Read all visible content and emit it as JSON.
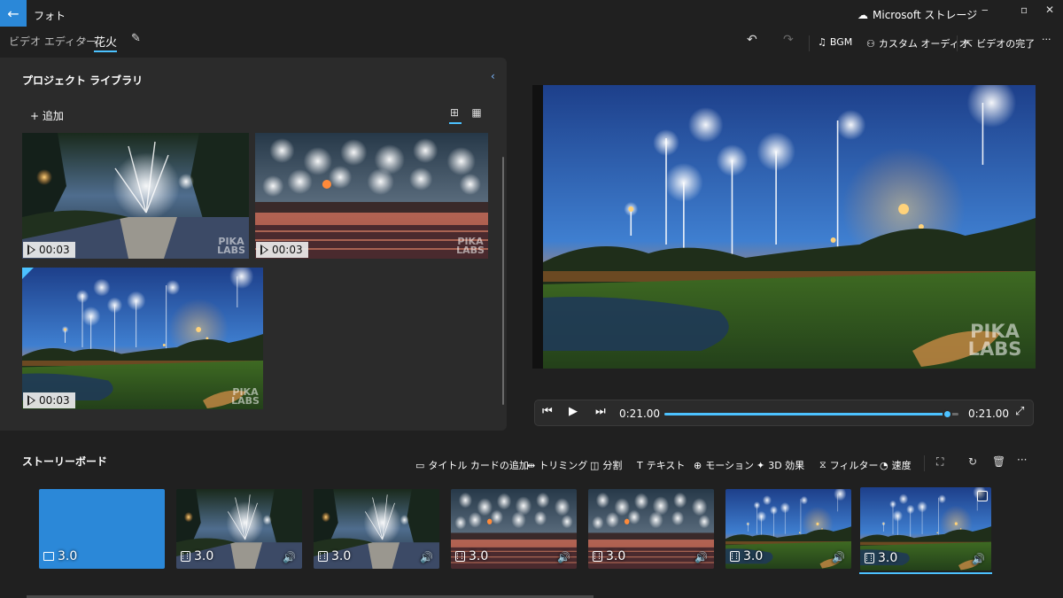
{
  "titlebar": {
    "app_name": "フォト",
    "storage_label": "Microsoft ストレージ",
    "minimize": "‒",
    "maximize": "▫",
    "close": "✕"
  },
  "breadcrumb": {
    "root": "ビデオ エディター",
    "separator": "›",
    "current": "花火"
  },
  "toolbar": {
    "bgm_label": "BGM",
    "custom_audio_label": "カスタム オーディオ",
    "finish_label": "ビデオの完了",
    "more": "···"
  },
  "library": {
    "title": "プロジェクト ライブラリ",
    "add_label": "+ 追加",
    "items": [
      {
        "duration": "00:03",
        "watermark": "PIKA LABS"
      },
      {
        "duration": "00:03",
        "watermark": "PIKA LABS"
      },
      {
        "duration": "00:03",
        "watermark": "PIKA LABS"
      }
    ]
  },
  "preview": {
    "watermark": "PIKA LABS"
  },
  "player": {
    "current_time": "0:21.00",
    "total_time": "0:21.00",
    "progress": 0.96
  },
  "storyboard": {
    "title": "ストーリーボード",
    "actions": {
      "title_card": "タイトル カードの追加",
      "trim": "トリミング",
      "split": "分割",
      "text": "テキスト",
      "motion": "モーション",
      "effects_3d": "3D 効果",
      "filter": "フィルター",
      "speed": "速度",
      "more": "···"
    },
    "clips": [
      {
        "duration": "3.0",
        "type": "title-card"
      },
      {
        "duration": "3.0",
        "type": "video"
      },
      {
        "duration": "3.0",
        "type": "video"
      },
      {
        "duration": "3.0",
        "type": "video"
      },
      {
        "duration": "3.0",
        "type": "video"
      },
      {
        "duration": "3.0",
        "type": "video"
      },
      {
        "duration": "3.0",
        "type": "video",
        "selected": true
      }
    ]
  },
  "colors": {
    "accent": "#4cc2ff",
    "title_card_blue": "#2b88d8",
    "panel": "#2b2b2b",
    "background": "#202020"
  }
}
